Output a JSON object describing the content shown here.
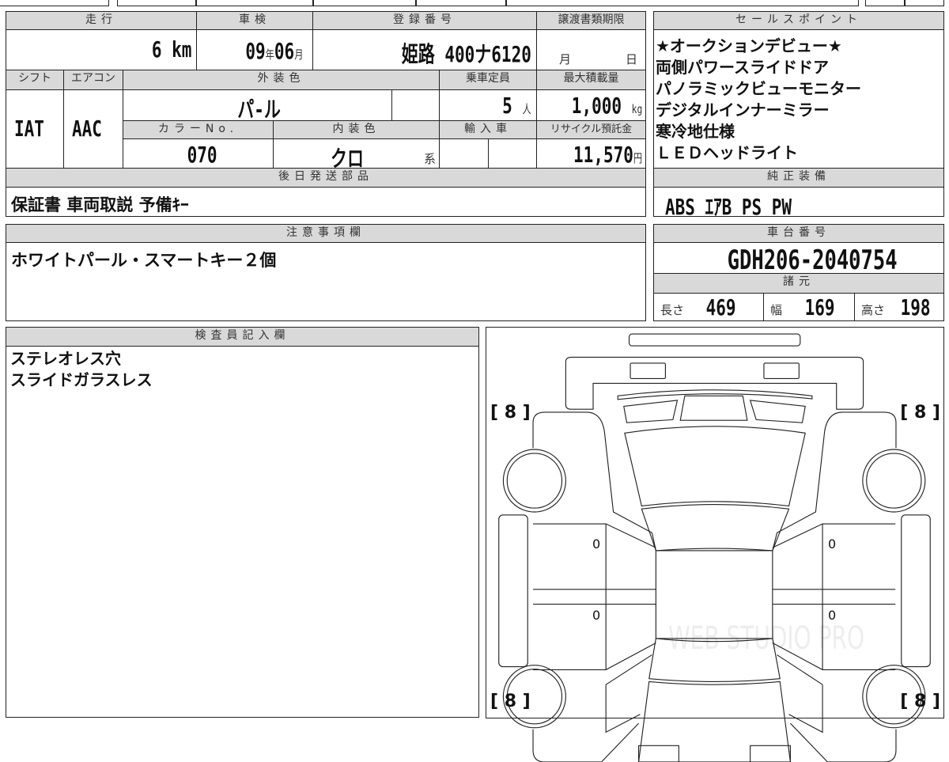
{
  "top": {
    "mileage": {
      "label": "走行",
      "value": "6",
      "unit": "km"
    },
    "inspection": {
      "label": "車検",
      "year": "09",
      "year_unit": "年",
      "month": "06",
      "month_unit": "月"
    },
    "registration": {
      "label": "登録番号",
      "value": "姫路 400ナ6120"
    },
    "transfer_deadline": {
      "label": "譲渡書類期限",
      "month_unit": "月",
      "day_unit": "日"
    },
    "shift": {
      "label": "シフト",
      "value": "IAT"
    },
    "aircon": {
      "label": "エアコン",
      "value": "AAC"
    },
    "exterior_color": {
      "label": "外装色",
      "value": "パ-ル"
    },
    "capacity": {
      "label": "乗車定員",
      "value": "5",
      "unit": "人"
    },
    "max_load": {
      "label": "最大積載量",
      "value": "1,000",
      "unit": "kg"
    },
    "color_no": {
      "label": "カラーNo.",
      "value": "070"
    },
    "interior_color": {
      "label": "内装色",
      "value": "クロ",
      "unit": "系"
    },
    "imported": {
      "label": "輸入車"
    },
    "recycle": {
      "label": "リサイクル預託金",
      "value": "11,570",
      "unit": "円"
    },
    "later_parts": {
      "label": "後日発送部品",
      "value": "保証書 車両取説 予備ｷｰ"
    }
  },
  "sales_points": {
    "label": "セールスポイント",
    "items": [
      "★オークションデビュー★",
      "両側パワースライドドア",
      "パノラミックビューモニター",
      "デジタルインナーミラー",
      "寒冷地仕様",
      "ＬＥＤヘッドライト"
    ]
  },
  "equipment": {
    "label": "純正装備",
    "value": "ABS ｴｱB PS PW"
  },
  "notes": {
    "label": "注意事項欄",
    "value": "ホワイトパール・スマートキー２個"
  },
  "chassis": {
    "label": "車台番号",
    "value": "GDH206-2040754"
  },
  "specs": {
    "label": "諸元",
    "length_label": "長さ",
    "length": "469",
    "width_label": "幅",
    "width": "169",
    "height_label": "高さ",
    "height": "198"
  },
  "inspector": {
    "label": "検査員記入欄",
    "lines": [
      "ステレオレス穴",
      "スライドガラスレス"
    ]
  },
  "diagram": {
    "tire_fl": "[ 8 ]",
    "tire_fr": "[ 8 ]",
    "tire_rl": "[ 8 ]",
    "tire_rr": "[ 8 ]",
    "door_marks": [
      "0",
      "0",
      "0",
      "0"
    ],
    "watermark": "WEB STUDIO PRO"
  }
}
